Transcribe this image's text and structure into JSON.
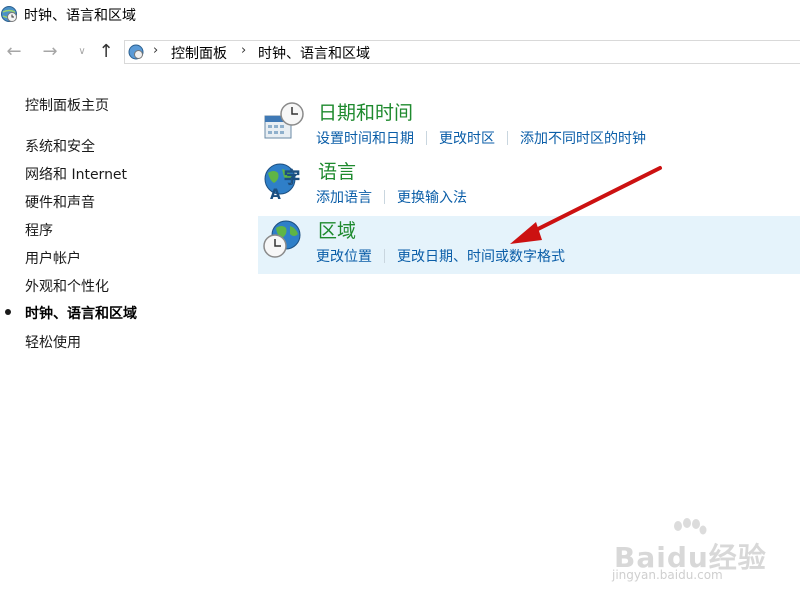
{
  "window": {
    "title": "时钟、语言和区域",
    "icon": "clock-globe-icon"
  },
  "nav": {
    "back_icon": "back-arrow-icon",
    "forward_icon": "forward-arrow-icon",
    "recent_icon": "chevron-down-icon",
    "up_icon": "up-arrow-icon",
    "breadcrumb": [
      "控制面板",
      "时钟、语言和区域"
    ]
  },
  "sidebar": {
    "home_label": "控制面板主页",
    "items": [
      {
        "label": "系统和安全",
        "active": false
      },
      {
        "label": "网络和 Internet",
        "active": false
      },
      {
        "label": "硬件和声音",
        "active": false
      },
      {
        "label": "程序",
        "active": false
      },
      {
        "label": "用户帐户",
        "active": false
      },
      {
        "label": "外观和个性化",
        "active": false
      },
      {
        "label": "时钟、语言和区域",
        "active": true
      },
      {
        "label": "轻松使用",
        "active": false
      }
    ]
  },
  "categories": [
    {
      "title": "日期和时间",
      "icon": "calendar-clock-icon",
      "links": [
        "设置时间和日期",
        "更改时区",
        "添加不同时区的时钟"
      ]
    },
    {
      "title": "语言",
      "icon": "language-globe-icon",
      "links": [
        "添加语言",
        "更换输入法"
      ]
    },
    {
      "title": "区域",
      "icon": "region-globe-clock-icon",
      "links": [
        "更改位置",
        "更改日期、时间或数字格式"
      ],
      "highlighted": true
    }
  ],
  "annotation": {
    "arrow_color": "#cc1111"
  },
  "watermark": {
    "logo_text": "Baidu经验",
    "url": "jingyan.baidu.com"
  },
  "colors": {
    "category_title": "#1e8a2e",
    "link": "#0b5ea8",
    "highlight": "#e5f3fb"
  }
}
